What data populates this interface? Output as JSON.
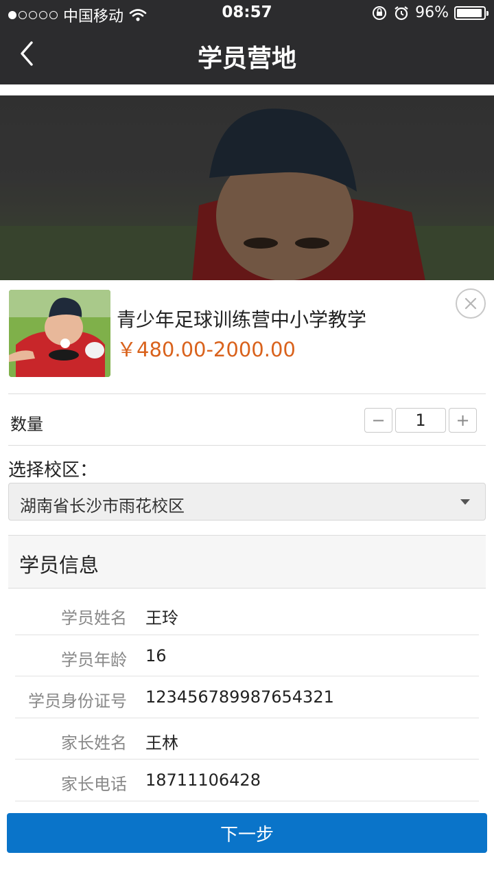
{
  "status_bar": {
    "carrier": "中国移动",
    "time": "08:57",
    "battery_pct": "96%",
    "battery_level": 0.96,
    "signal_dots_on": 1,
    "signal_dots_total": 5,
    "icons": [
      "wifi-icon",
      "rotation-lock-icon",
      "alarm-icon",
      "battery-icon"
    ]
  },
  "nav": {
    "title": "学员营地",
    "back_icon": "chevron-left-icon"
  },
  "product": {
    "title": "青少年足球训练营中小学教学",
    "price": "￥480.00-2000.00",
    "price_color": "#d9621c"
  },
  "quantity": {
    "label": "数量",
    "minus": "−",
    "value": "1",
    "plus": "+"
  },
  "campus": {
    "label": "选择校区：",
    "selected": "湖南省长沙市雨花校区"
  },
  "student_info": {
    "heading": "学员信息",
    "fields": [
      {
        "label": "学员姓名",
        "value": "王玲"
      },
      {
        "label": "学员年龄",
        "value": "16"
      },
      {
        "label": "学员身份证号",
        "value": "123456789987654321"
      },
      {
        "label": "家长姓名",
        "value": "王林"
      },
      {
        "label": "家长电话",
        "value": "18711106428"
      }
    ]
  },
  "next_button": {
    "label": "下一步",
    "color": "#0a74c9"
  }
}
